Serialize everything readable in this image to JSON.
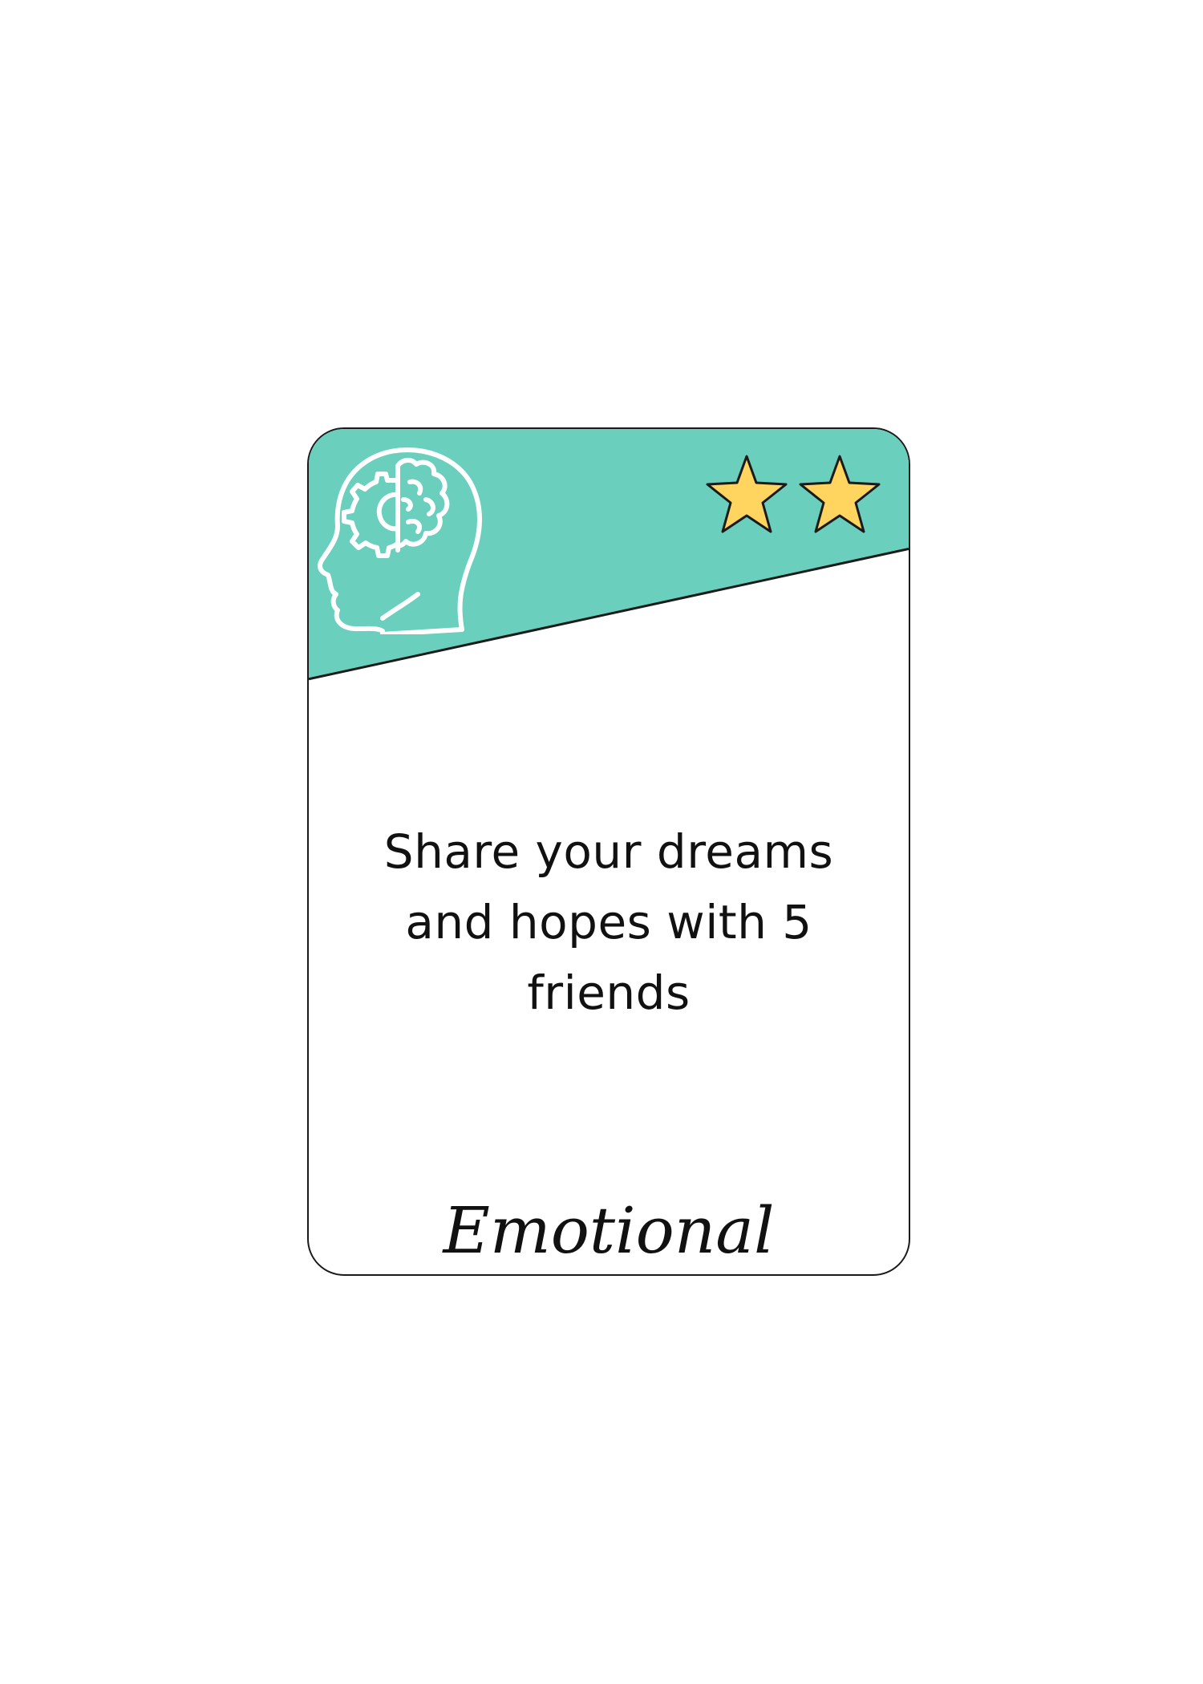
{
  "card": {
    "prompt": "Share your dreams and hopes with 5 friends",
    "category": "Emotional",
    "difficulty_stars": 2,
    "icon": "head-brain-gear-icon",
    "header_color": "#6acfbc",
    "star_color": "#ffd45f",
    "border_color": "#1a1a1a"
  }
}
